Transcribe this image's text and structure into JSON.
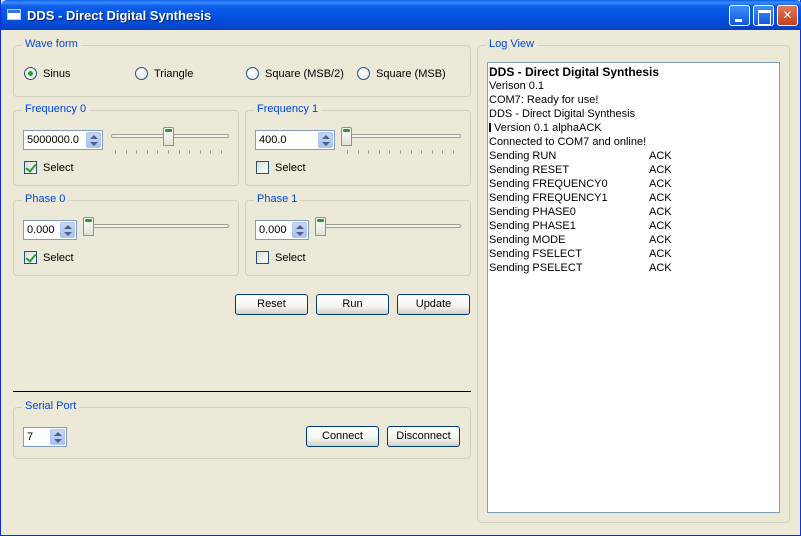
{
  "window": {
    "title": "DDS - Direct Digital Synthesis"
  },
  "waveform": {
    "label": "Wave form",
    "options": [
      {
        "label": "Sinus",
        "checked": true
      },
      {
        "label": "Triangle",
        "checked": false
      },
      {
        "label": "Square (MSB/2)",
        "checked": false
      },
      {
        "label": "Square (MSB)",
        "checked": false
      }
    ]
  },
  "frequency0": {
    "label": "Frequency 0",
    "value": "5000000.0",
    "select_label": "Select",
    "selected": true,
    "slider_fraction": 0.5
  },
  "frequency1": {
    "label": "Frequency 1",
    "value": "400.0",
    "select_label": "Select",
    "selected": false,
    "slider_fraction": 0.0
  },
  "phase0": {
    "label": "Phase 0",
    "value": "0.000",
    "select_label": "Select",
    "selected": true,
    "slider_fraction": 0.0
  },
  "phase1": {
    "label": "Phase 1",
    "value": "0.000",
    "select_label": "Select",
    "selected": false,
    "slider_fraction": 0.0
  },
  "actions": {
    "reset_label": "Reset",
    "run_label": "Run",
    "update_label": "Update"
  },
  "serial": {
    "label": "Serial Port",
    "port": "7",
    "connect_label": "Connect",
    "disconnect_label": "Disconnect"
  },
  "log": {
    "label": "Log View",
    "lines": [
      {
        "text": "DDS - Direct Digital Synthesis",
        "bold": true
      },
      {
        "text": "Verison 0.1"
      },
      {
        "text": "COM7: Ready for use!"
      },
      {
        "text": "DDS - Direct Digital Synthesis"
      },
      {
        "text": "Version 0.1 alphaACK",
        "marker": true
      },
      {
        "text": "Connected to COM7 and online!"
      },
      {
        "text": "Sending RUN",
        "ack": "ACK"
      },
      {
        "text": "Sending RESET",
        "ack": "ACK"
      },
      {
        "text": "Sending FREQUENCY0",
        "ack": "ACK"
      },
      {
        "text": "Sending FREQUENCY1",
        "ack": "ACK"
      },
      {
        "text": "Sending PHASE0",
        "ack": "ACK"
      },
      {
        "text": "Sending PHASE1",
        "ack": "ACK"
      },
      {
        "text": "Sending MODE",
        "ack": "ACK"
      },
      {
        "text": "Sending FSELECT",
        "ack": "ACK"
      },
      {
        "text": "Sending PSELECT",
        "ack": "ACK"
      }
    ]
  },
  "colors": {
    "group_label": "#0046d5",
    "check_mark": "#21a121",
    "titlebar": "#0453e0"
  }
}
